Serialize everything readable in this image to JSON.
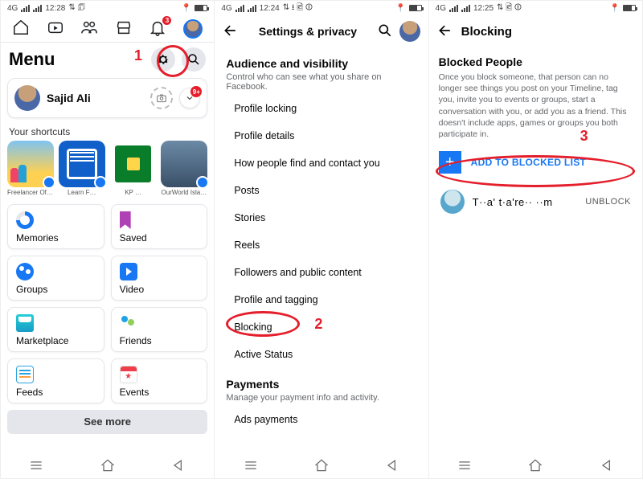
{
  "screen1": {
    "status": {
      "net": "4G",
      "time": "12:28",
      "icons": "⇅ 🗊"
    },
    "tabbar_badge": "3",
    "menu_title": "Menu",
    "profile_name": "Sajid Ali",
    "profile_more_badge": "9+",
    "shortcuts_title": "Your shortcuts",
    "shortcuts": [
      {
        "label": "Freelancer Of Upwork Fiv…"
      },
      {
        "label": "Learn F…"
      },
      {
        "label": "KP …"
      },
      {
        "label": "OurWorld Islam…"
      }
    ],
    "tiles": [
      {
        "label": "Memories",
        "icon": "memories"
      },
      {
        "label": "Saved",
        "icon": "saved"
      },
      {
        "label": "Groups",
        "icon": "groups"
      },
      {
        "label": "Video",
        "icon": "video"
      },
      {
        "label": "Marketplace",
        "icon": "marketplace"
      },
      {
        "label": "Friends",
        "icon": "friends"
      },
      {
        "label": "Feeds",
        "icon": "feeds"
      },
      {
        "label": "Events",
        "icon": "events"
      }
    ],
    "see_more": "See more",
    "annotation_number": "1"
  },
  "screen2": {
    "status": {
      "net": "4G",
      "time": "12:24",
      "icons": "⇅ ⭳ 🖻 ⏼"
    },
    "appbar_title": "Settings & privacy",
    "section1": {
      "title": "Audience and visibility",
      "desc": "Control who can see what you share on Facebook.",
      "items": [
        "Profile locking",
        "Profile details",
        "How people find and contact you",
        "Posts",
        "Stories",
        "Reels",
        "Followers and public content",
        "Profile and tagging",
        "Blocking",
        "Active Status"
      ]
    },
    "section2": {
      "title": "Payments",
      "desc": "Manage your payment info and activity.",
      "items": [
        "Ads payments"
      ]
    },
    "annotation_number": "2"
  },
  "screen3": {
    "status": {
      "net": "4G",
      "time": "12:25",
      "icons": "⇅ 🖻 ⏼"
    },
    "appbar_title": "Blocking",
    "section": {
      "title": "Blocked People",
      "desc": "Once you block someone, that person can no longer see things you post on your Timeline, tag you, invite you to events or groups, start a conversation with you, or add you as a friend. This doesn't include apps, games or groups you both participate in."
    },
    "add_label": "ADD TO BLOCKED LIST",
    "blocked": [
      {
        "name": "T··a' t·a're·· ··m",
        "action": "UNBLOCK"
      }
    ],
    "annotation_number": "3"
  }
}
